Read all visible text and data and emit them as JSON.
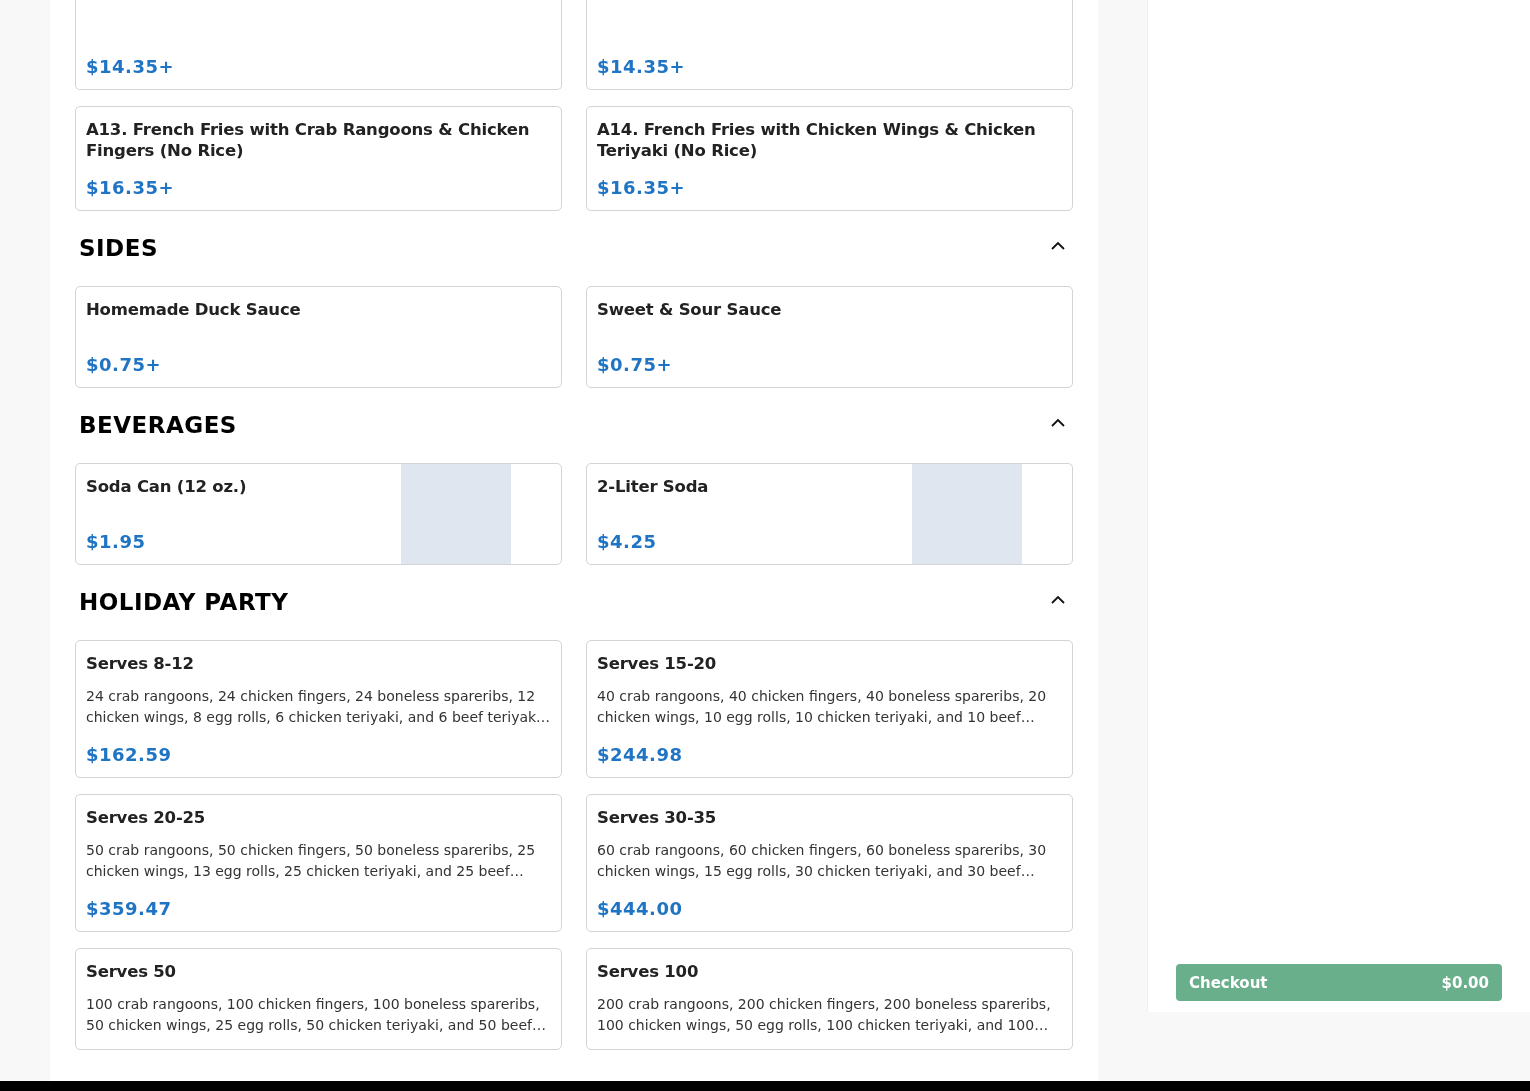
{
  "sections": [
    {
      "items": [
        {
          "price": "$14.35+"
        },
        {
          "price": "$14.35+"
        },
        {
          "title": "A13. French Fries with Crab Rangoons & Chicken Fingers (No Rice)",
          "price": "$16.35+"
        },
        {
          "title": "A14. French Fries with Chicken Wings & Chicken Teriyaki (No Rice)",
          "price": "$16.35+"
        }
      ]
    },
    {
      "title": "SIDES",
      "expanded": true,
      "items": [
        {
          "title": "Homemade Duck Sauce",
          "price": "$0.75+"
        },
        {
          "title": "Sweet & Sour Sauce",
          "price": "$0.75+"
        }
      ]
    },
    {
      "title": "BEVERAGES",
      "expanded": true,
      "items": [
        {
          "title": "Soda Can (12 oz.)",
          "price": "$1.95",
          "photo": true
        },
        {
          "title": "2-Liter Soda",
          "price": "$4.25",
          "photo": true
        }
      ]
    },
    {
      "title": "HOLIDAY PARTY",
      "expanded": true,
      "items": [
        {
          "title": "Serves 8-12",
          "description": "24 crab rangoons, 24 chicken fingers, 24 boneless spareribs, 12 chicken wings, 8 egg rolls, 6 chicken teriyaki, and 6 beef teriyak…",
          "price": "$162.59"
        },
        {
          "title": "Serves 15-20",
          "description": "40 crab rangoons, 40 chicken fingers, 40 boneless spareribs, 20 chicken wings, 10 egg rolls, 10 chicken teriyaki, and 10 beef…",
          "price": "$244.98"
        },
        {
          "title": "Serves 20-25",
          "description": "50 crab rangoons, 50 chicken fingers, 50 boneless spareribs, 25 chicken wings, 13 egg rolls, 25 chicken teriyaki, and 25 beef…",
          "price": "$359.47"
        },
        {
          "title": "Serves 30-35",
          "description": "60 crab rangoons, 60 chicken fingers, 60 boneless spareribs, 30 chicken wings, 15 egg rolls, 30 chicken teriyaki, and 30 beef…",
          "price": "$444.00"
        },
        {
          "title": "Serves 50",
          "description": "100 crab rangoons, 100 chicken fingers, 100 boneless spareribs, 50 chicken wings, 25 egg rolls, 50 chicken teriyaki, and 50 beef…"
        },
        {
          "title": "Serves 100",
          "description": "200 crab rangoons, 200 chicken fingers, 200 boneless spareribs, 100 chicken wings, 50 egg rolls, 100 chicken teriyaki, and 100…"
        }
      ]
    }
  ],
  "checkout": {
    "label": "Checkout",
    "total": "$0.00"
  }
}
